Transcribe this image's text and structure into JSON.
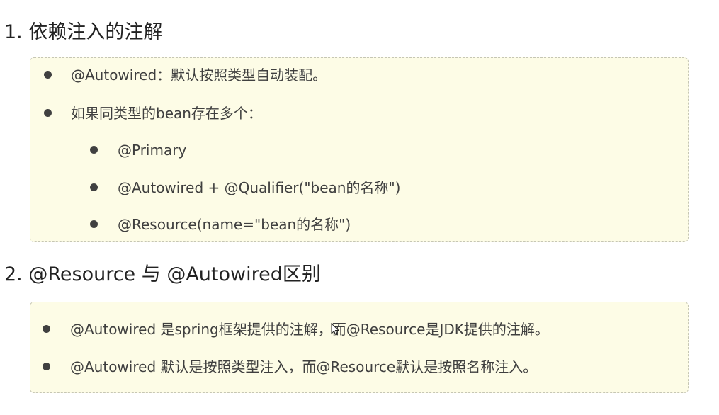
{
  "section1": {
    "heading": "1. 依赖注入的注解",
    "items": [
      "@Autowired：默认按照类型自动装配。",
      "如果同类型的bean存在多个："
    ],
    "subitems": [
      "@Primary",
      "@Autowired + @Qualifier(\"bean的名称\")",
      "@Resource(name=\"bean的名称\")"
    ]
  },
  "section2": {
    "heading": "2. @Resource 与 @Autowired区别",
    "items": [
      "@Autowired 是spring框架提供的注解，而@Resource是JDK提供的注解。",
      "@Autowired 默认是按照类型注入，而@Resource默认是按照名称注入。"
    ]
  }
}
